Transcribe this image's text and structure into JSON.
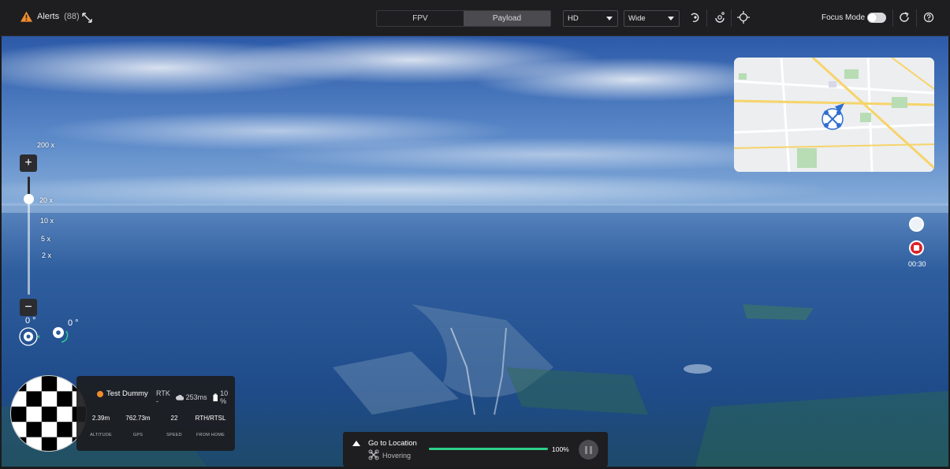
{
  "alerts": {
    "label": "Alerts",
    "count": "(88)",
    "icon": "warning-triangle-icon",
    "color": "#f08c2e"
  },
  "view_tabs": [
    {
      "label": "FPV",
      "active": false
    },
    {
      "label": "Payload",
      "active": true
    }
  ],
  "quality_select": {
    "value": "HD"
  },
  "lens_select": {
    "value": "Wide"
  },
  "toolbar_icons": [
    "gimbal-reset-icon",
    "gimbal-rotate-icon",
    "target-crosshair-icon"
  ],
  "focus_mode": {
    "label": "Focus Mode",
    "on": false
  },
  "zoom": {
    "labels": [
      "200 x",
      "20 x",
      "10 x",
      "5 x",
      "2 x"
    ]
  },
  "gimbal": {
    "pitch": "0 °",
    "yaw": "0 °"
  },
  "recording": {
    "time": "00:30",
    "record_color": "#d9242a"
  },
  "telemetry": {
    "drone_name": "Test Dummy",
    "rtk": "RTK -",
    "latency": "253ms",
    "battery": "10 %",
    "stats": [
      {
        "value": "2.39m",
        "label": "ALTITUDE"
      },
      {
        "value": "762.73m",
        "label": "GPS"
      },
      {
        "value": "22",
        "label": "SPEED"
      },
      {
        "value": "RTH/RTSL",
        "label": "FROM HOME"
      }
    ]
  },
  "mission": {
    "title": "Go to Location",
    "status": "Hovering",
    "progress_label": "100%",
    "progress": 1.0,
    "accent": "#2ecf8a"
  }
}
